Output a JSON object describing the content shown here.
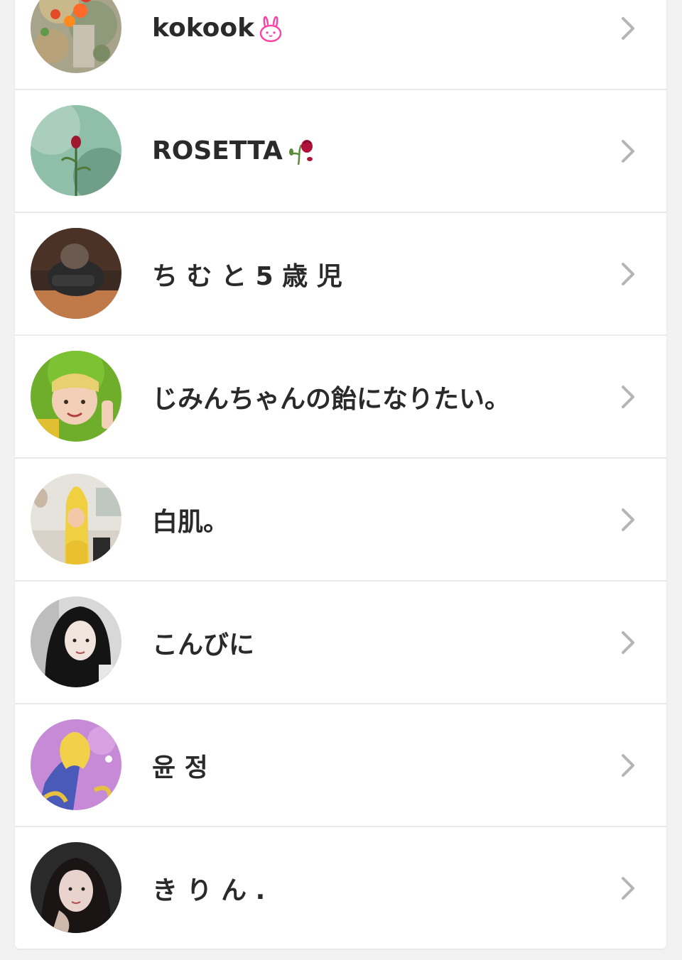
{
  "friends": [
    {
      "name": "kokook",
      "deco_icon": "rabbit-face-icon",
      "avatar": "avatar-photo-flowers"
    },
    {
      "name": "ROSETTA",
      "deco_icon": "wilted-rose-icon",
      "avatar": "avatar-photo-rose"
    },
    {
      "name": "ち む と 5 歳 児",
      "deco_icon": "",
      "avatar": "avatar-photo-person"
    },
    {
      "name": "じみんちゃんの飴になりたい。",
      "deco_icon": "",
      "avatar": "avatar-photo-costume"
    },
    {
      "name": "白肌。",
      "deco_icon": "",
      "avatar": "avatar-photo-banana"
    },
    {
      "name": "こんびに",
      "deco_icon": "",
      "avatar": "avatar-photo-portrait"
    },
    {
      "name": "윤 정",
      "deco_icon": "",
      "avatar": "avatar-photo-anime"
    },
    {
      "name": "き り ん .",
      "deco_icon": "",
      "avatar": "avatar-photo-selfie"
    }
  ],
  "colors": {
    "background": "#f2f2f2",
    "card": "#ffffff",
    "divider": "#e9e9e9",
    "text": "#2a2a2a",
    "chevron": "#b5b5b5",
    "rabbit_pink": "#ff3fa6",
    "rose_red": "#b0123a"
  }
}
